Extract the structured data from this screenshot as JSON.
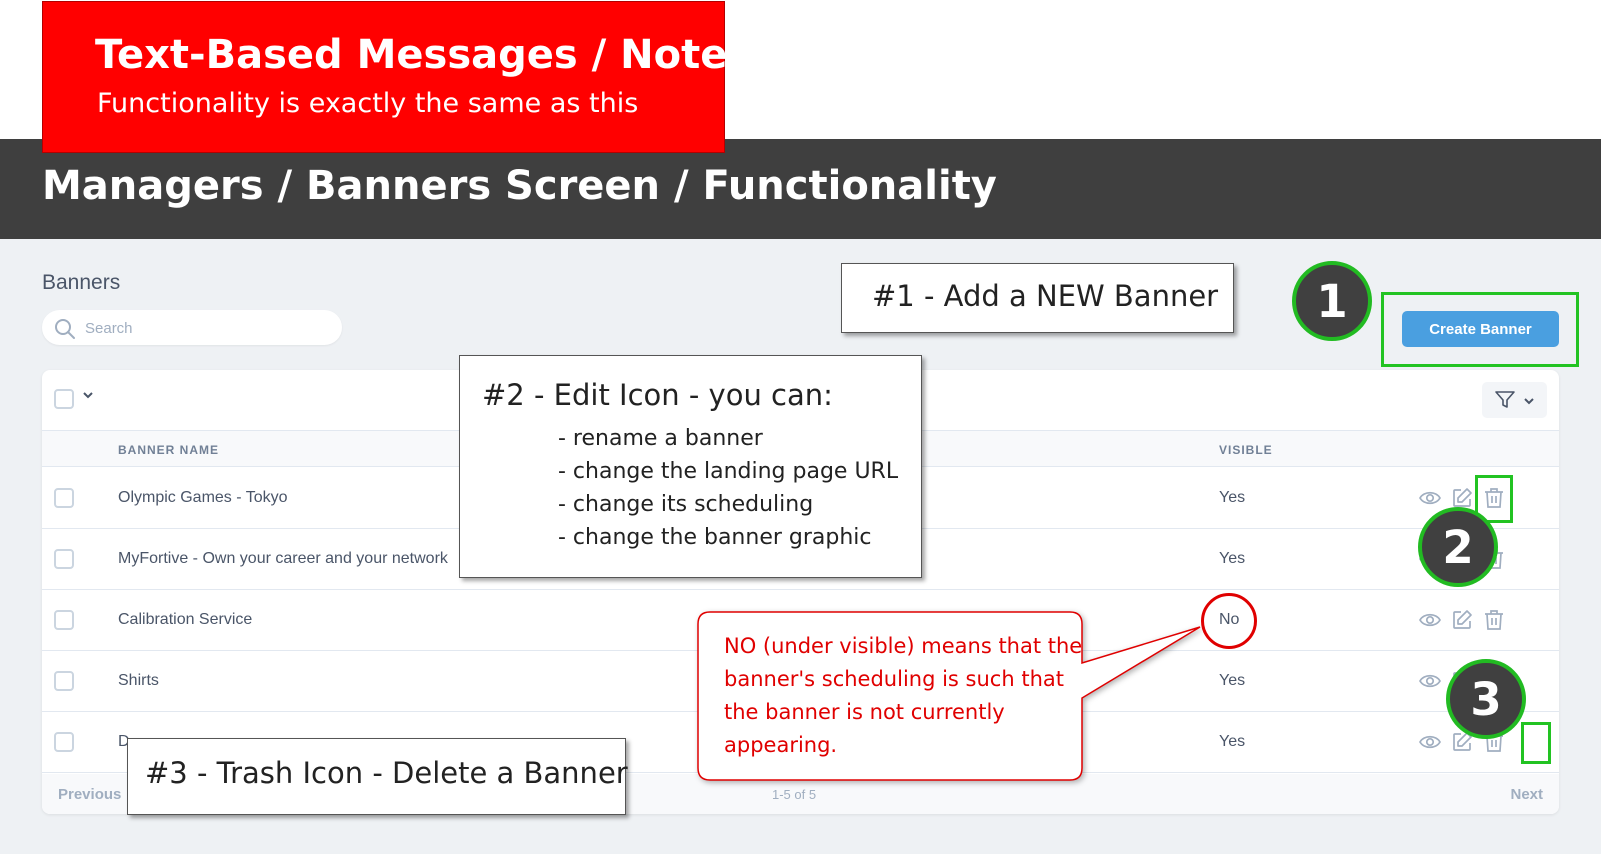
{
  "annotation_header": {
    "title": "Text-Based Messages / Notes",
    "subtitle": "Functionality is exactly the same as this"
  },
  "section_header": {
    "title": "Managers / Banners Screen / Functionality"
  },
  "app": {
    "page_title": "Banners",
    "search": {
      "placeholder": "Search",
      "value": ""
    },
    "create_button": "Create Banner",
    "table": {
      "columns": [
        "BANNER NAME",
        "VISIBLE"
      ],
      "rows": [
        {
          "name": "Olympic Games - Tokyo",
          "visible": "Yes"
        },
        {
          "name": "MyFortive - Own your career and your network",
          "visible": "Yes"
        },
        {
          "name": "Calibration Service",
          "visible": "No"
        },
        {
          "name": "Shirts",
          "visible": "Yes"
        },
        {
          "name": "D",
          "visible": "Yes"
        }
      ]
    },
    "pagination": {
      "previous": "Previous",
      "count": "1-5 of 5",
      "next": "Next"
    }
  },
  "callouts": {
    "add": "#1 - Add a NEW Banner",
    "edit": {
      "title": "#2 - Edit Icon - you can:",
      "items": [
        "- rename a banner",
        "- change the landing page URL",
        "- change its scheduling",
        "- change the banner graphic"
      ]
    },
    "trash": "#3 - Trash Icon - Delete a Banner",
    "note": "NO (under visible) means that the banner's scheduling is such that the banner is not currently appearing."
  },
  "markers": [
    "1",
    "2",
    "3"
  ],
  "icons": [
    "search-icon",
    "chevron-down-icon",
    "filter-icon",
    "eye-icon",
    "edit-icon",
    "trash-icon"
  ],
  "colors": {
    "accent": "#4a9fe0",
    "annotation_red": "#ff0000",
    "highlight_green": "#22c322",
    "header_dark": "#3f3f3f"
  }
}
